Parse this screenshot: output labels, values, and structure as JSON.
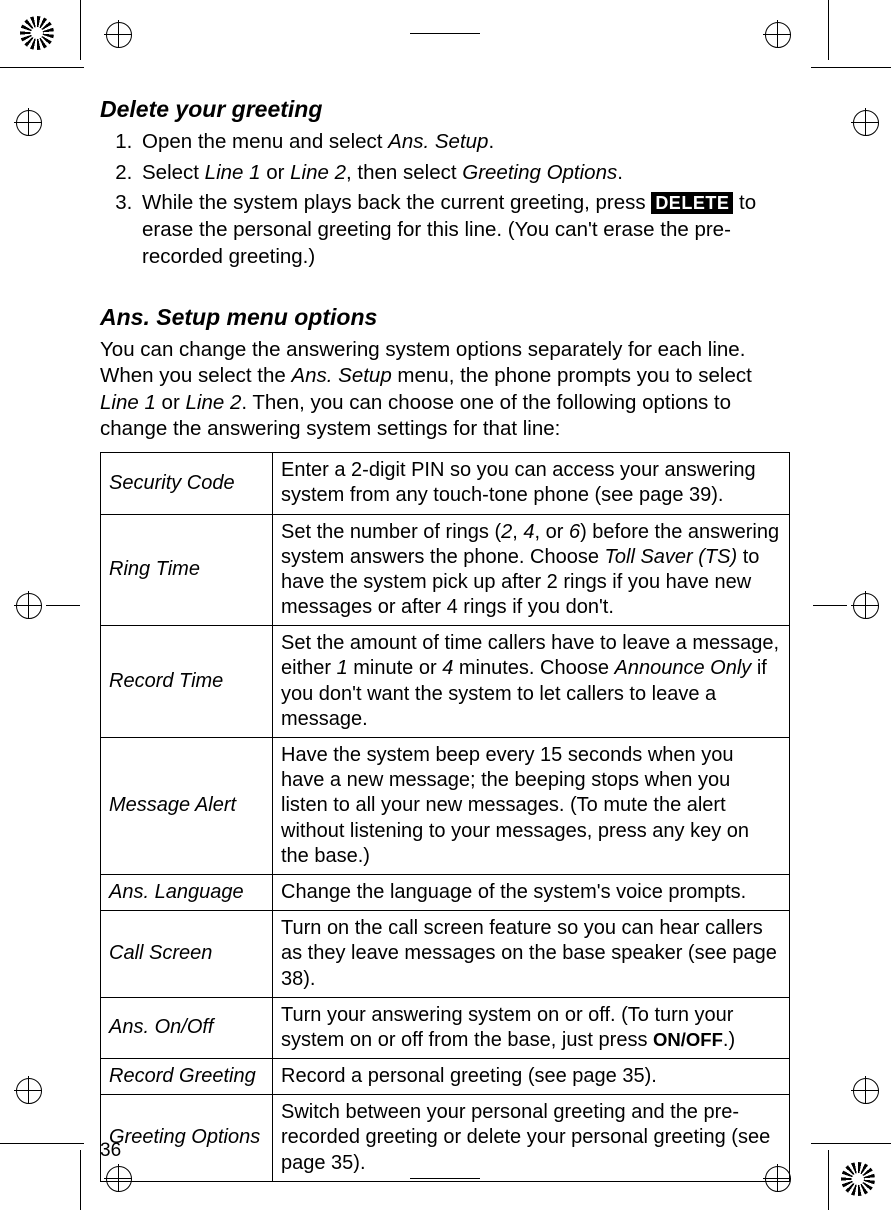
{
  "page_number": "36",
  "section1": {
    "heading": "Delete your greeting",
    "steps": [
      {
        "pre": "Open the menu and select ",
        "it1": "Ans. Setup",
        "post": "."
      },
      {
        "pre": "Select ",
        "it1": "Line 1",
        "mid1": " or ",
        "it2": "Line 2",
        "mid2": ", then select ",
        "it3": "Greeting Options",
        "post": "."
      },
      {
        "pre": "While the system plays back the current greeting, press ",
        "key": "DELETE",
        "post": " to erase the personal greeting for this line. (You can't erase the pre-recorded greeting.)"
      }
    ]
  },
  "section2": {
    "heading": "Ans. Setup menu options",
    "intro_pre": "You can change the answering system options separately for each line. When you select the ",
    "intro_it1": "Ans. Setup",
    "intro_mid1": " menu, the phone prompts you to select ",
    "intro_it2": "Line 1",
    "intro_mid2": " or ",
    "intro_it3": "Line 2",
    "intro_post": ". Then, you can choose one of the following options to change the answering system settings for that line:",
    "rows": [
      {
        "opt": "Security Code",
        "desc_parts": [
          {
            "t": "Enter a 2-digit PIN so you can access your answering system from any touch-tone phone (see page 39)."
          }
        ]
      },
      {
        "opt": "Ring Time",
        "desc_parts": [
          {
            "t": "Set the number of rings ("
          },
          {
            "t": "2",
            "it": true
          },
          {
            "t": ", "
          },
          {
            "t": "4",
            "it": true
          },
          {
            "t": ", or "
          },
          {
            "t": "6",
            "it": true
          },
          {
            "t": ") before the answering system answers the phone. Choose "
          },
          {
            "t": "Toll Saver (TS)",
            "it": true
          },
          {
            "t": " to have the system pick up after 2 rings if you have new messages or after 4 rings if you don't."
          }
        ]
      },
      {
        "opt": "Record Time",
        "desc_parts": [
          {
            "t": "Set the amount of time callers have to leave a message, either "
          },
          {
            "t": "1",
            "it": true
          },
          {
            "t": " minute or "
          },
          {
            "t": "4",
            "it": true
          },
          {
            "t": " minutes. Choose "
          },
          {
            "t": "Announce Only",
            "it": true
          },
          {
            "t": " if you don't want the system to let callers to leave a message."
          }
        ]
      },
      {
        "opt": "Message Alert",
        "desc_parts": [
          {
            "t": "Have the system beep every 15 seconds when you have a new message; the beeping stops when you listen to all your new messages. (To mute the alert without listening to your messages, press any key on the base.)"
          }
        ]
      },
      {
        "opt": "Ans. Language",
        "desc_parts": [
          {
            "t": "Change the language of the system's voice prompts."
          }
        ]
      },
      {
        "opt": "Call Screen",
        "desc_parts": [
          {
            "t": "Turn on the call screen feature so you can hear callers as they leave messages on the base speaker (see page 38)."
          }
        ]
      },
      {
        "opt": "Ans. On/Off",
        "desc_parts": [
          {
            "t": "Turn your answering system on or off. (To turn your system on or off from the base, just press "
          },
          {
            "t": "ON/OFF",
            "bold": true
          },
          {
            "t": ".)"
          }
        ]
      },
      {
        "opt": "Record Greeting",
        "desc_parts": [
          {
            "t": "Record a personal greeting (see page 35)."
          }
        ]
      },
      {
        "opt": "Greeting Options",
        "desc_parts": [
          {
            "t": "Switch between your personal greeting and the pre-recorded greeting or delete your personal greeting (see page 35)."
          }
        ]
      }
    ]
  }
}
